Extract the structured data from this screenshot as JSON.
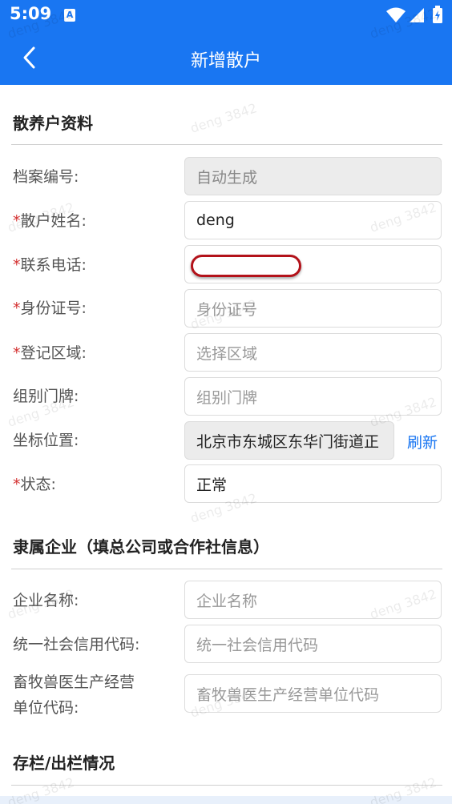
{
  "status_bar": {
    "time": "5:09",
    "notification_icon_label": "A"
  },
  "app_bar": {
    "title": "新增散户"
  },
  "section1": {
    "title": "散养户资料",
    "fields": {
      "archive_no": {
        "label": "档案编号:",
        "value": "自动生成"
      },
      "name": {
        "label": "散户姓名:",
        "value": "deng"
      },
      "phone": {
        "label": "联系电话:",
        "value": ""
      },
      "id_no": {
        "label": "身份证号:",
        "placeholder": "身份证号"
      },
      "area": {
        "label": "登记区域:",
        "placeholder": "选择区域"
      },
      "house_no": {
        "label": "组别门牌:",
        "placeholder": "组别门牌"
      },
      "location": {
        "label": "坐标位置:",
        "value": "北京市东城区东华门街道正",
        "refresh_label": "刷新"
      },
      "status": {
        "label": "状态:",
        "value": "正常"
      }
    },
    "required_mark": "*"
  },
  "section2": {
    "title": "隶属企业（填总公司或合作社信息）",
    "fields": {
      "company_name": {
        "label": "企业名称:",
        "placeholder": "企业名称"
      },
      "credit_code": {
        "label": "统一社会信用代码:",
        "placeholder": "统一社会信用代码"
      },
      "vet_code": {
        "label_line1": "畜牧兽医生产经营",
        "label_line2": "单位代码:",
        "placeholder": "畜牧兽医生产经营单位代码"
      }
    }
  },
  "section3": {
    "title": "存栏/出栏情况"
  },
  "watermark": "deng 3842",
  "colors": {
    "primary": "#1976f2",
    "required": "#d32f2f",
    "link": "#1976f2"
  }
}
